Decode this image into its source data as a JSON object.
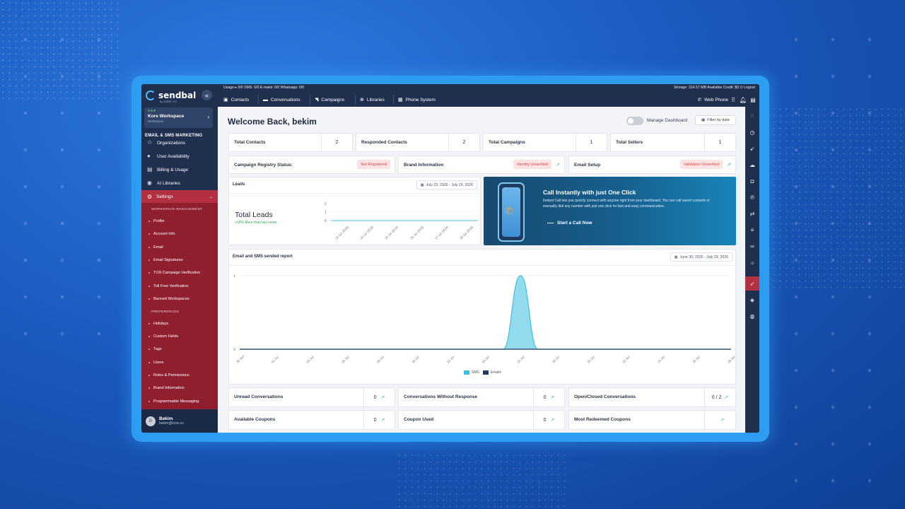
{
  "brand": {
    "name": "sendbal",
    "sub": "by KORE.CO"
  },
  "workspace": {
    "name": "Kore Workspace",
    "sub": "Workspace"
  },
  "sidebar": {
    "section_title": "EMAIL & SMS MARKETING",
    "items": [
      {
        "label": "Organizations",
        "icon": "globe-icon"
      },
      {
        "label": "User Availability",
        "icon": "user-icon"
      },
      {
        "label": "Billing & Usage",
        "icon": "billing-icon"
      },
      {
        "label": "AI Libraries",
        "icon": "ai-icon"
      }
    ],
    "settings": {
      "label": "Settings"
    },
    "workspace_mgmt_title": "WORKSPACE MANAGEMENT",
    "workspace_items": [
      "Profile",
      "Account Info",
      "Email",
      "Email Signatures",
      "TCR Campaign Verification",
      "Toll Free Verification",
      "Banned Workspaces"
    ],
    "preferences_title": "PREFERENCES",
    "preference_items": [
      "Holidays",
      "Custom Fields",
      "Tags",
      "Users",
      "Roles & Permissions",
      "Brand Information",
      "Programmable Messaging"
    ]
  },
  "user": {
    "initial": "B",
    "name": "Bekim",
    "email": "bekim@kore.co"
  },
  "topbar": {
    "usage": "Usage ▸   0/0   SMS: 0/0   E-mails: 0/0   Whatsapp: 0/0",
    "storage": "Storage: 314.57 MB   Available Credit: $0   ⏻ Logout",
    "nav": [
      "Contacts",
      "Conversations",
      "Campaigns",
      "Libraries",
      "Phone System"
    ],
    "web_phone": "Web Phone"
  },
  "main": {
    "title": "Welcome Back, bekim",
    "manage_dashboard": "Manage Dashboard",
    "filter_by_date": "Filter by date"
  },
  "stats": [
    {
      "label": "Total Contacts",
      "value": "2"
    },
    {
      "label": "Responded Contacts",
      "value": "2"
    },
    {
      "label": "Total Campaigns",
      "value": "1"
    },
    {
      "label": "Total Sellers",
      "value": "1"
    }
  ],
  "status_cards": [
    {
      "label": "Campaign Registry Status:",
      "badge": "Not Registered"
    },
    {
      "label": "Brand Information",
      "badge": "Identity Unverified"
    },
    {
      "label": "Email Setup",
      "badge": "Validation Unverified"
    }
  ],
  "leads": {
    "title": "Leads",
    "date_range": "July 23, 2026 - July 29, 2026",
    "total_label": "Total Leads",
    "change": "+16% More than last week",
    "y_ticks": [
      "2",
      "1",
      "0"
    ],
    "x_ticks": [
      "23 Jul 18:00",
      "24 Jul 18:00",
      "25 Jul 18:00",
      "26 Jul 18:00",
      "27 Jul 18:00",
      "28 Jul 18:00"
    ]
  },
  "promo": {
    "title": "Call Instantly with just One Click",
    "text": "Instant Call lets you quickly connect with anyone right from your dashboard. You can call saved contacts or manually dial any number with just one click for fast and easy communication.",
    "cta": "Start a Call Now"
  },
  "report": {
    "title": "Email and SMS sended report",
    "date_range": "June 30, 2026 - July 29, 2026"
  },
  "chart_data": {
    "type": "area",
    "title": "Email and SMS sended report",
    "x": [
      "30 Jun",
      "02 Jul",
      "04 Jul",
      "06 Jul",
      "08 Jul",
      "10 Jul",
      "12 Jul",
      "14 Jul",
      "16 Jul",
      "18 Jul",
      "20 Jul",
      "22 Jul",
      "24 Jul",
      "26 Jul",
      "28 Jul"
    ],
    "y_ticks": [
      "1",
      "0"
    ],
    "ylim": [
      0,
      1
    ],
    "series": [
      {
        "name": "SMS",
        "color": "#3bbfe0",
        "points": [
          [
            0,
            0
          ],
          [
            1,
            0
          ],
          [
            2,
            0
          ],
          [
            3,
            0
          ],
          [
            4,
            0
          ],
          [
            5,
            0
          ],
          [
            6,
            0
          ],
          [
            7,
            0
          ],
          [
            7.5,
            0
          ],
          [
            8,
            1
          ],
          [
            8.5,
            0
          ],
          [
            9,
            0
          ],
          [
            10,
            0
          ],
          [
            11,
            0
          ],
          [
            12,
            0
          ],
          [
            13,
            0
          ],
          [
            14,
            0
          ]
        ]
      },
      {
        "name": "Emails",
        "color": "#1f3b5e",
        "points": [
          [
            0,
            0
          ],
          [
            14,
            0
          ]
        ]
      }
    ],
    "legend": "bottom-center"
  },
  "bottom_cards": [
    {
      "label": "Unread Conversations",
      "value": "0"
    },
    {
      "label": "Conversations Without Response",
      "value": "0"
    },
    {
      "label": "Open/Closed Conversations",
      "value": "0 / 2"
    },
    {
      "label": "Available Coupons",
      "value": "0"
    },
    {
      "label": "Coupon Used",
      "value": "0"
    },
    {
      "label": "Most Redeemed Coupons",
      "value": ""
    }
  ],
  "colors": {
    "accent": "#3bbfe0",
    "navy": "#1f2f4d",
    "settings_red": "#8f1f2e",
    "badge_red": "#d64545"
  }
}
